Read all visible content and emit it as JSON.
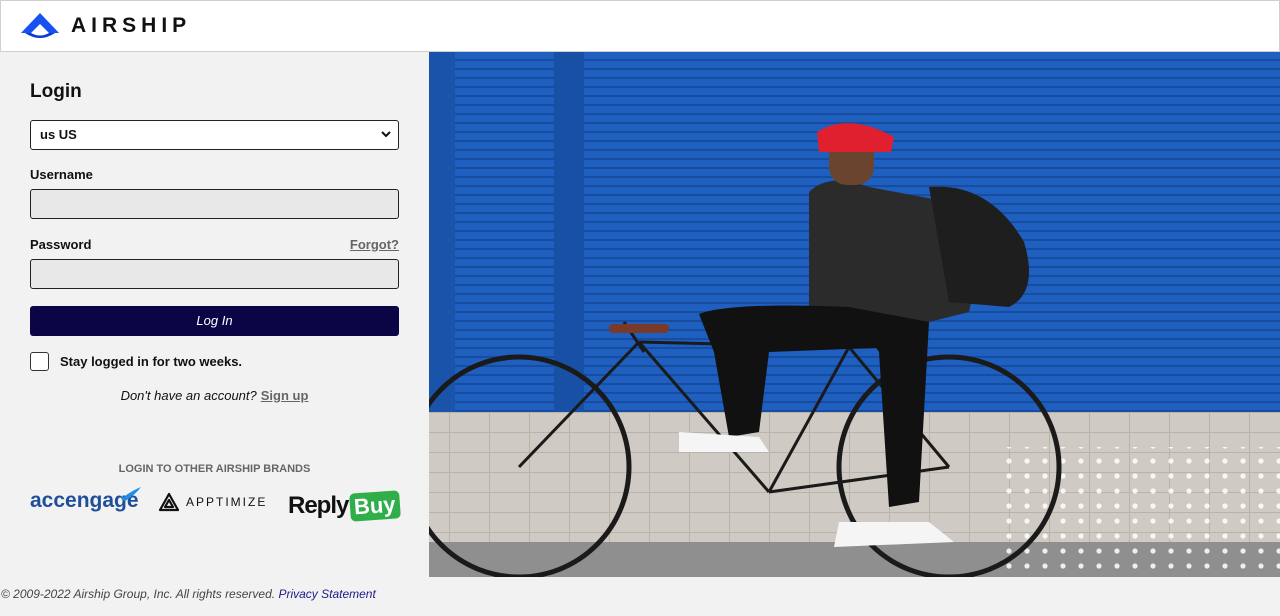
{
  "header": {
    "brand": "AIRSHIP"
  },
  "login": {
    "title": "Login",
    "region_selected": "us US",
    "username_label": "Username",
    "username_value": "",
    "password_label": "Password",
    "password_value": "",
    "forgot_label": "Forgot?",
    "login_button": "Log In",
    "stay_logged_in": "Stay logged in for two weeks.",
    "no_account_text": "Don't have an account?",
    "signup_label": "Sign up"
  },
  "brands": {
    "heading": "LOGIN TO OTHER AIRSHIP BRANDS",
    "items": [
      {
        "name": "accengage"
      },
      {
        "name": "APPTIMIZE"
      },
      {
        "reply": "Reply",
        "buy": "Buy"
      }
    ]
  },
  "footer": {
    "copyright": "© 2009-2022 Airship Group, Inc. All rights reserved.",
    "privacy_label": "Privacy Statement"
  },
  "colors": {
    "brand_navy": "#0a0645",
    "brand_blue": "#1652f0",
    "hero_blue": "#1e5fc0",
    "replybuy_green": "#2fae4a"
  }
}
